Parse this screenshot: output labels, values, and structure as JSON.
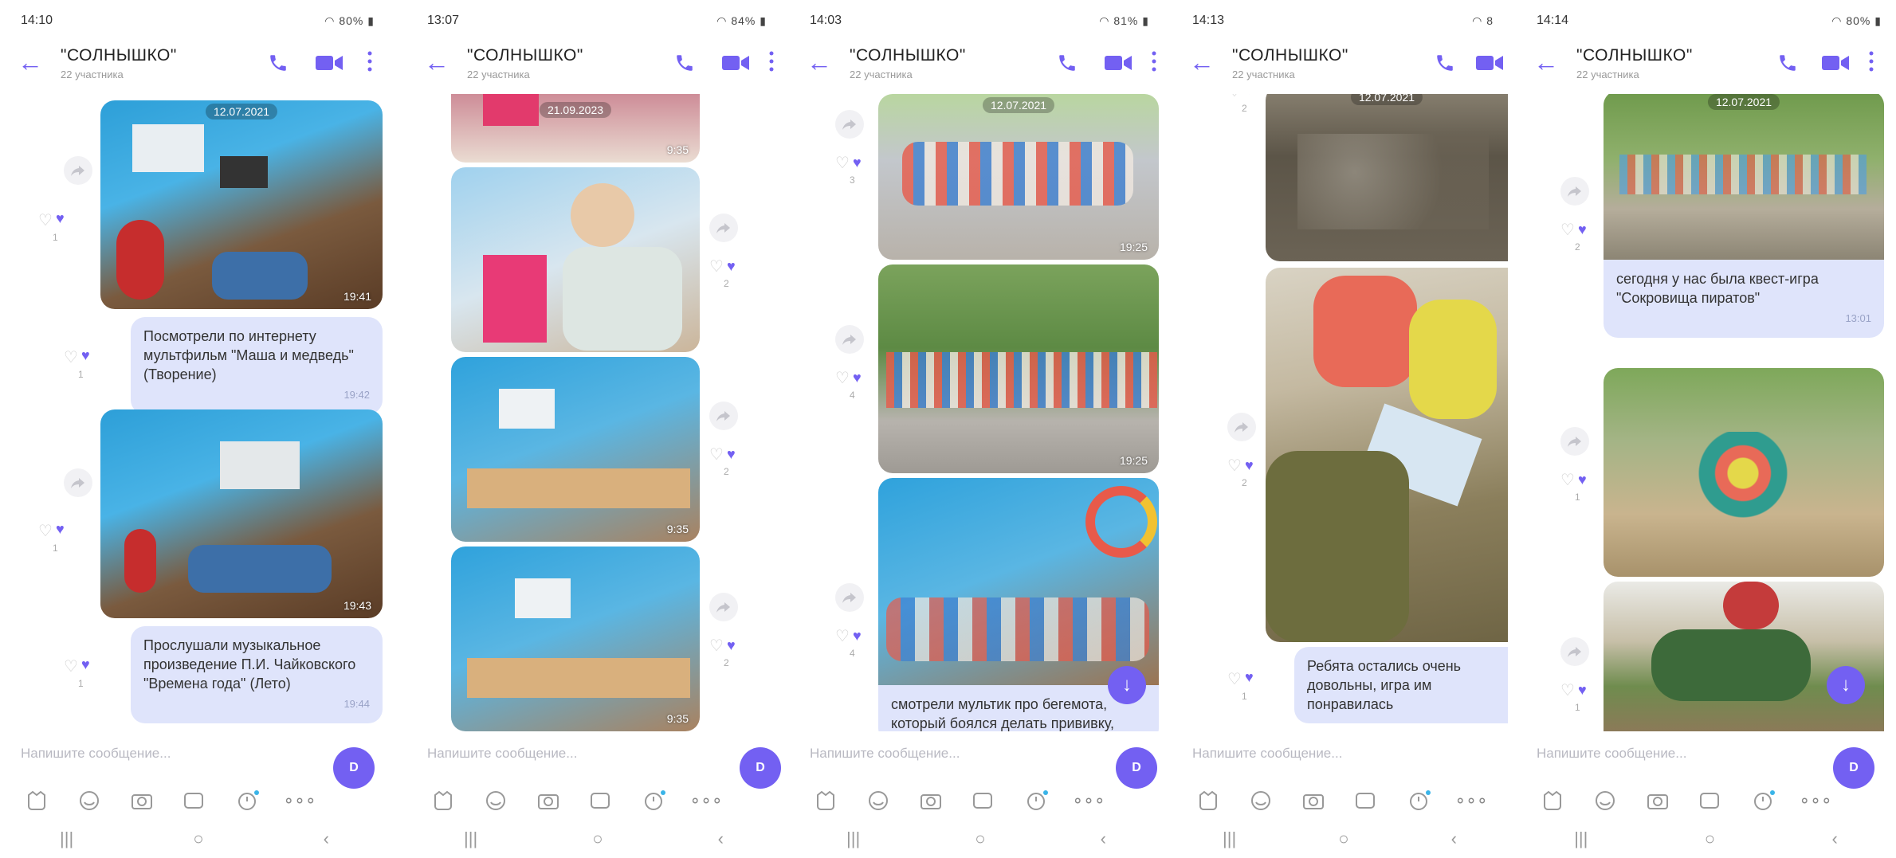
{
  "app": {
    "title": "\"СОЛНЫШКО\"",
    "subtitle": "22 участника",
    "input_placeholder": "Напишите сообщение...",
    "accent_color": "#7360f2",
    "bubble_color": "#dfe4fb"
  },
  "screens": [
    {
      "status_time": "14:10",
      "status_battery": "80%",
      "photo_dates": [
        "12.07.2021"
      ],
      "photo_times": [
        "19:41",
        "19:43"
      ],
      "messages": [
        {
          "text": "Посмотрели по интернету мультфильм \"Маша и медведь\" (Творение)",
          "time": "19:42"
        },
        {
          "text": "Прослушали музыкальное произведение П.И. Чайковского \"Времена года\" (Лето)",
          "time": "19:44"
        }
      ],
      "counts": [
        "1",
        "1",
        "1",
        "1",
        "1"
      ]
    },
    {
      "status_time": "13:07",
      "status_battery": "84%",
      "photo_dates": [
        "21.09.2023"
      ],
      "photo_times": [
        "9:35",
        "9:35",
        "9:35"
      ],
      "counts": [
        "2",
        "2",
        "2"
      ]
    },
    {
      "status_time": "14:03",
      "status_battery": "81%",
      "photo_dates": [
        "12.07.2021"
      ],
      "photo_times": [
        "19:25",
        "19:25"
      ],
      "messages": [
        {
          "text": "смотрели мультик про бегемота, который боялся делать прививку,"
        }
      ],
      "counts": [
        "3",
        "4",
        "4"
      ]
    },
    {
      "status_time": "14:13",
      "status_battery": "8",
      "photo_dates": [
        "12.07.2021"
      ],
      "messages": [
        {
          "text": "Ребята остались очень довольны, игра им понравилась"
        }
      ],
      "counts": [
        "2",
        "2",
        "1"
      ]
    },
    {
      "status_time": "14:14",
      "status_battery": "80%",
      "photo_dates": [
        "12.07.2021"
      ],
      "messages": [
        {
          "text": "сегодня у нас была квест-игра \"Сокровища пиратов\"",
          "time": "13:01"
        }
      ],
      "counts": [
        "2",
        "1",
        "1"
      ]
    }
  ]
}
